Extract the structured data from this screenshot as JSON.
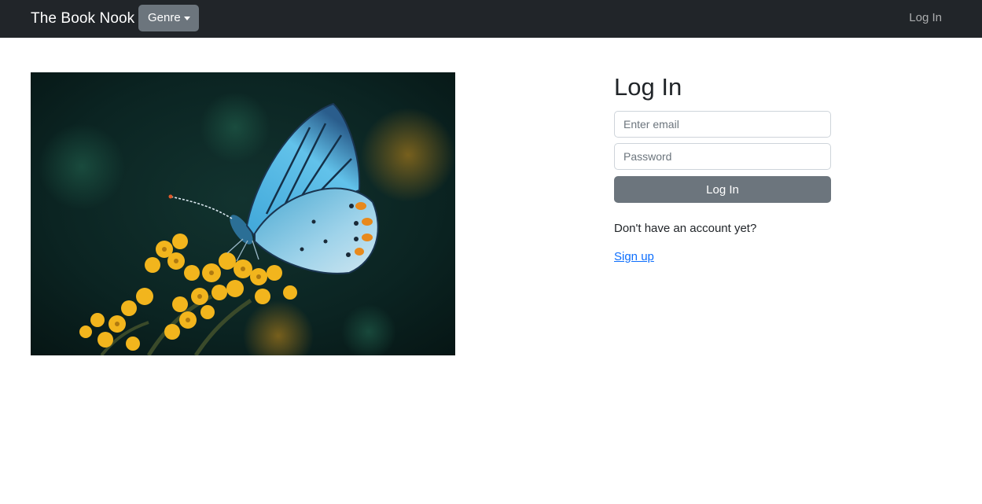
{
  "navbar": {
    "brand": "The Book Nook",
    "genre_label": "Genre",
    "login_link": "Log In"
  },
  "hero": {
    "image": "butterfly-on-yellow-flowers"
  },
  "login_form": {
    "heading": "Log In",
    "email_placeholder": "Enter email",
    "email_value": "",
    "password_placeholder": "Password",
    "password_value": "",
    "submit_label": "Log In",
    "no_account_text": "Don't have an account yet?",
    "signup_label": "Sign up"
  },
  "colors": {
    "navbar_bg": "#212529",
    "secondary": "#6c757d",
    "link": "#0d6efd"
  }
}
